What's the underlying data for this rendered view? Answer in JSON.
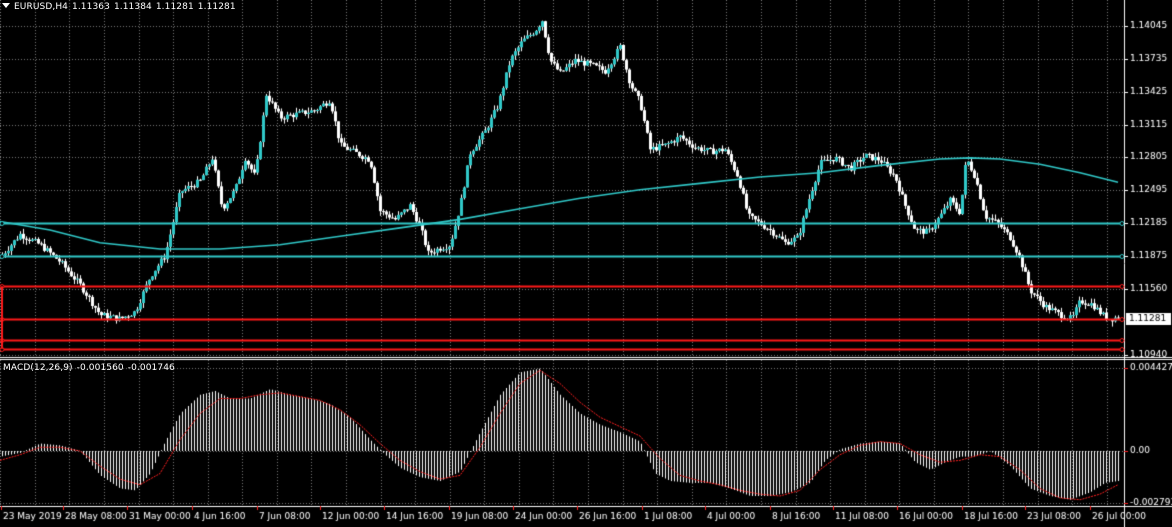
{
  "main_header": {
    "symbol": "EURUSD,H4",
    "open": "1.11363",
    "high": "1.11384",
    "low": "1.11281",
    "close": "1.11281"
  },
  "macd_header": {
    "label": "MACD(12,26,9)",
    "main": "-0.001560",
    "signal": "-0.001746"
  },
  "current_price": "1.11281",
  "colors": {
    "background": "#000000",
    "grid": "#7a7a7a",
    "candle": "#ffffff",
    "bull_body": "#30c8c8",
    "bear_body": "#ffffff",
    "moving_average": "#30c8c8",
    "support_cyan": "#30c8c8",
    "resistance_red": "#ff1a1a",
    "macd_hist": "#ffffff",
    "macd_signal": "#ff2020"
  },
  "chart_data": [
    {
      "type": "candlestick",
      "title": "EURUSD,H4",
      "ylim": [
        1.1094,
        1.1418
      ],
      "y_ticks": [
        "1.14045",
        "1.13735",
        "1.13425",
        "1.13115",
        "1.12805",
        "1.12495",
        "1.12185",
        "1.11875",
        "1.11560",
        "1.10940"
      ],
      "x_ticks": [
        "23 May 2019",
        "28 May 08:00",
        "31 May 00:00",
        "4 Jun 16:00",
        "7 Jun 08:00",
        "12 Jun 00:00",
        "14 Jun 16:00",
        "19 Jun 08:00",
        "24 Jun 00:00",
        "26 Jun 16:00",
        "1 Jul 08:00",
        "4 Jul 00:00",
        "8 Jul 16:00",
        "11 Jul 08:00",
        "16 Jul 00:00",
        "18 Jul 16:00",
        "23 Jul 08:00",
        "26 Jul 00:00"
      ],
      "close_path": [
        [
          0,
          1.1186
        ],
        [
          20,
          1.1208
        ],
        [
          40,
          1.1198
        ],
        [
          60,
          1.1182
        ],
        [
          80,
          1.116
        ],
        [
          100,
          1.1132
        ],
        [
          120,
          1.1128
        ],
        [
          135,
          1.1135
        ],
        [
          150,
          1.1168
        ],
        [
          165,
          1.1188
        ],
        [
          180,
          1.1248
        ],
        [
          200,
          1.1258
        ],
        [
          212,
          1.128
        ],
        [
          222,
          1.1232
        ],
        [
          235,
          1.125
        ],
        [
          245,
          1.128
        ],
        [
          255,
          1.1262
        ],
        [
          266,
          1.134
        ],
        [
          280,
          1.1318
        ],
        [
          300,
          1.1322
        ],
        [
          315,
          1.1325
        ],
        [
          330,
          1.1335
        ],
        [
          340,
          1.1292
        ],
        [
          355,
          1.1285
        ],
        [
          370,
          1.1278
        ],
        [
          380,
          1.123
        ],
        [
          395,
          1.1222
        ],
        [
          410,
          1.1235
        ],
        [
          420,
          1.1215
        ],
        [
          428,
          1.119
        ],
        [
          440,
          1.1195
        ],
        [
          450,
          1.1198
        ],
        [
          460,
          1.1235
        ],
        [
          470,
          1.1285
        ],
        [
          485,
          1.1305
        ],
        [
          498,
          1.133
        ],
        [
          510,
          1.1372
        ],
        [
          522,
          1.139
        ],
        [
          535,
          1.14
        ],
        [
          542,
          1.141
        ],
        [
          550,
          1.1372
        ],
        [
          560,
          1.136
        ],
        [
          575,
          1.1372
        ],
        [
          590,
          1.1368
        ],
        [
          605,
          1.1362
        ],
        [
          620,
          1.1385
        ],
        [
          630,
          1.135
        ],
        [
          640,
          1.1332
        ],
        [
          650,
          1.1288
        ],
        [
          665,
          1.1292
        ],
        [
          680,
          1.13
        ],
        [
          695,
          1.129
        ],
        [
          710,
          1.1286
        ],
        [
          725,
          1.1288
        ],
        [
          738,
          1.1262
        ],
        [
          748,
          1.1225
        ],
        [
          760,
          1.1218
        ],
        [
          770,
          1.1212
        ],
        [
          785,
          1.12
        ],
        [
          798,
          1.1205
        ],
        [
          810,
          1.1245
        ],
        [
          820,
          1.1275
        ],
        [
          835,
          1.128
        ],
        [
          850,
          1.127
        ],
        [
          865,
          1.1282
        ],
        [
          880,
          1.1278
        ],
        [
          895,
          1.1262
        ],
        [
          905,
          1.1235
        ],
        [
          915,
          1.1212
        ],
        [
          928,
          1.121
        ],
        [
          940,
          1.1225
        ],
        [
          950,
          1.124
        ],
        [
          960,
          1.1228
        ],
        [
          966,
          1.128
        ],
        [
          975,
          1.1262
        ],
        [
          985,
          1.1225
        ],
        [
          998,
          1.1218
        ],
        [
          1010,
          1.1205
        ],
        [
          1020,
          1.1185
        ],
        [
          1030,
          1.1155
        ],
        [
          1045,
          1.114
        ],
        [
          1060,
          1.1132
        ],
        [
          1072,
          1.1128
        ],
        [
          1080,
          1.1145
        ],
        [
          1092,
          1.1142
        ],
        [
          1102,
          1.1132
        ],
        [
          1110,
          1.1128
        ],
        [
          1118,
          1.113
        ]
      ],
      "moving_average": [
        [
          0,
          1.122
        ],
        [
          50,
          1.1212
        ],
        [
          100,
          1.12
        ],
        [
          160,
          1.1194
        ],
        [
          220,
          1.1194
        ],
        [
          280,
          1.1198
        ],
        [
          340,
          1.1206
        ],
        [
          400,
          1.1214
        ],
        [
          460,
          1.1222
        ],
        [
          520,
          1.1232
        ],
        [
          580,
          1.1242
        ],
        [
          640,
          1.125
        ],
        [
          700,
          1.1256
        ],
        [
          760,
          1.1262
        ],
        [
          820,
          1.1266
        ],
        [
          880,
          1.1273
        ],
        [
          940,
          1.1279
        ],
        [
          970,
          1.128
        ],
        [
          1000,
          1.1279
        ],
        [
          1040,
          1.1274
        ],
        [
          1080,
          1.1266
        ],
        [
          1118,
          1.1257
        ]
      ],
      "horizontal_lines": [
        {
          "price": 1.12185,
          "color": "cyan"
        },
        {
          "price": 1.11875,
          "color": "cyan"
        },
        {
          "price": 1.1159,
          "color": "red"
        },
        {
          "price": 1.11281,
          "color": "red"
        },
        {
          "price": 1.1108,
          "color": "red"
        },
        {
          "price": 1.11,
          "color": "red"
        }
      ]
    },
    {
      "type": "bar",
      "title": "MACD(12,26,9)",
      "ylim": [
        -0.0031,
        0.0047
      ],
      "y_ticks": [
        "0.004427",
        "0.00",
        "-0.002793"
      ],
      "histogram_path": [
        [
          0,
          -0.0003
        ],
        [
          20,
          -0.0001
        ],
        [
          40,
          0.0004
        ],
        [
          60,
          0.0003
        ],
        [
          80,
          0.0
        ],
        [
          100,
          -0.0013
        ],
        [
          120,
          -0.002
        ],
        [
          135,
          -0.0021
        ],
        [
          150,
          -0.0012
        ],
        [
          165,
          0.0005
        ],
        [
          180,
          0.002
        ],
        [
          200,
          0.003
        ],
        [
          215,
          0.0032
        ],
        [
          230,
          0.0028
        ],
        [
          250,
          0.0028
        ],
        [
          270,
          0.0033
        ],
        [
          290,
          0.003
        ],
        [
          310,
          0.0028
        ],
        [
          330,
          0.0025
        ],
        [
          350,
          0.0018
        ],
        [
          370,
          0.0006
        ],
        [
          385,
          -0.0002
        ],
        [
          400,
          -0.0009
        ],
        [
          420,
          -0.0014
        ],
        [
          440,
          -0.0016
        ],
        [
          460,
          -0.0011
        ],
        [
          480,
          0.001
        ],
        [
          500,
          0.003
        ],
        [
          520,
          0.0042
        ],
        [
          540,
          0.0044
        ],
        [
          560,
          0.003
        ],
        [
          580,
          0.002
        ],
        [
          600,
          0.0014
        ],
        [
          620,
          0.001
        ],
        [
          640,
          0.0005
        ],
        [
          655,
          -0.0012
        ],
        [
          670,
          -0.0016
        ],
        [
          690,
          -0.0017
        ],
        [
          710,
          -0.0017
        ],
        [
          730,
          -0.002
        ],
        [
          750,
          -0.0024
        ],
        [
          770,
          -0.0024
        ],
        [
          790,
          -0.0022
        ],
        [
          810,
          -0.0017
        ],
        [
          825,
          -0.0005
        ],
        [
          840,
          0.0001
        ],
        [
          860,
          0.0004
        ],
        [
          880,
          0.0005
        ],
        [
          900,
          0.0004
        ],
        [
          915,
          -0.0006
        ],
        [
          930,
          -0.001
        ],
        [
          945,
          -0.0006
        ],
        [
          960,
          -0.0003
        ],
        [
          975,
          -0.0003
        ],
        [
          990,
          0.0
        ],
        [
          1010,
          -0.0008
        ],
        [
          1030,
          -0.002
        ],
        [
          1050,
          -0.0024
        ],
        [
          1070,
          -0.0026
        ],
        [
          1090,
          -0.0022
        ],
        [
          1105,
          -0.0017
        ],
        [
          1118,
          -0.0016
        ]
      ],
      "signal_path": [
        [
          0,
          -0.0005
        ],
        [
          20,
          -0.0002
        ],
        [
          40,
          0.0002
        ],
        [
          60,
          0.0002
        ],
        [
          80,
          0.0
        ],
        [
          100,
          -0.0008
        ],
        [
          120,
          -0.0015
        ],
        [
          140,
          -0.0018
        ],
        [
          160,
          -0.0012
        ],
        [
          180,
          0.0006
        ],
        [
          200,
          0.002
        ],
        [
          220,
          0.0028
        ],
        [
          240,
          0.0028
        ],
        [
          260,
          0.003
        ],
        [
          280,
          0.0031
        ],
        [
          300,
          0.0029
        ],
        [
          320,
          0.0027
        ],
        [
          340,
          0.0022
        ],
        [
          360,
          0.0014
        ],
        [
          380,
          0.0004
        ],
        [
          400,
          -0.0005
        ],
        [
          420,
          -0.0011
        ],
        [
          440,
          -0.0015
        ],
        [
          460,
          -0.0013
        ],
        [
          480,
          0.0002
        ],
        [
          500,
          0.002
        ],
        [
          520,
          0.0036
        ],
        [
          540,
          0.0043
        ],
        [
          560,
          0.0036
        ],
        [
          580,
          0.0026
        ],
        [
          600,
          0.0018
        ],
        [
          620,
          0.0013
        ],
        [
          640,
          0.0008
        ],
        [
          660,
          -0.0004
        ],
        [
          680,
          -0.0013
        ],
        [
          700,
          -0.0016
        ],
        [
          720,
          -0.0018
        ],
        [
          740,
          -0.0021
        ],
        [
          760,
          -0.0023
        ],
        [
          780,
          -0.0024
        ],
        [
          800,
          -0.0021
        ],
        [
          820,
          -0.001
        ],
        [
          840,
          -0.0002
        ],
        [
          860,
          0.0003
        ],
        [
          880,
          0.0005
        ],
        [
          900,
          0.0004
        ],
        [
          920,
          -0.0002
        ],
        [
          940,
          -0.0006
        ],
        [
          960,
          -0.0005
        ],
        [
          980,
          -0.0002
        ],
        [
          1000,
          -0.0003
        ],
        [
          1020,
          -0.001
        ],
        [
          1040,
          -0.002
        ],
        [
          1060,
          -0.0025
        ],
        [
          1080,
          -0.0026
        ],
        [
          1100,
          -0.0023
        ],
        [
          1118,
          -0.0018
        ]
      ]
    }
  ]
}
